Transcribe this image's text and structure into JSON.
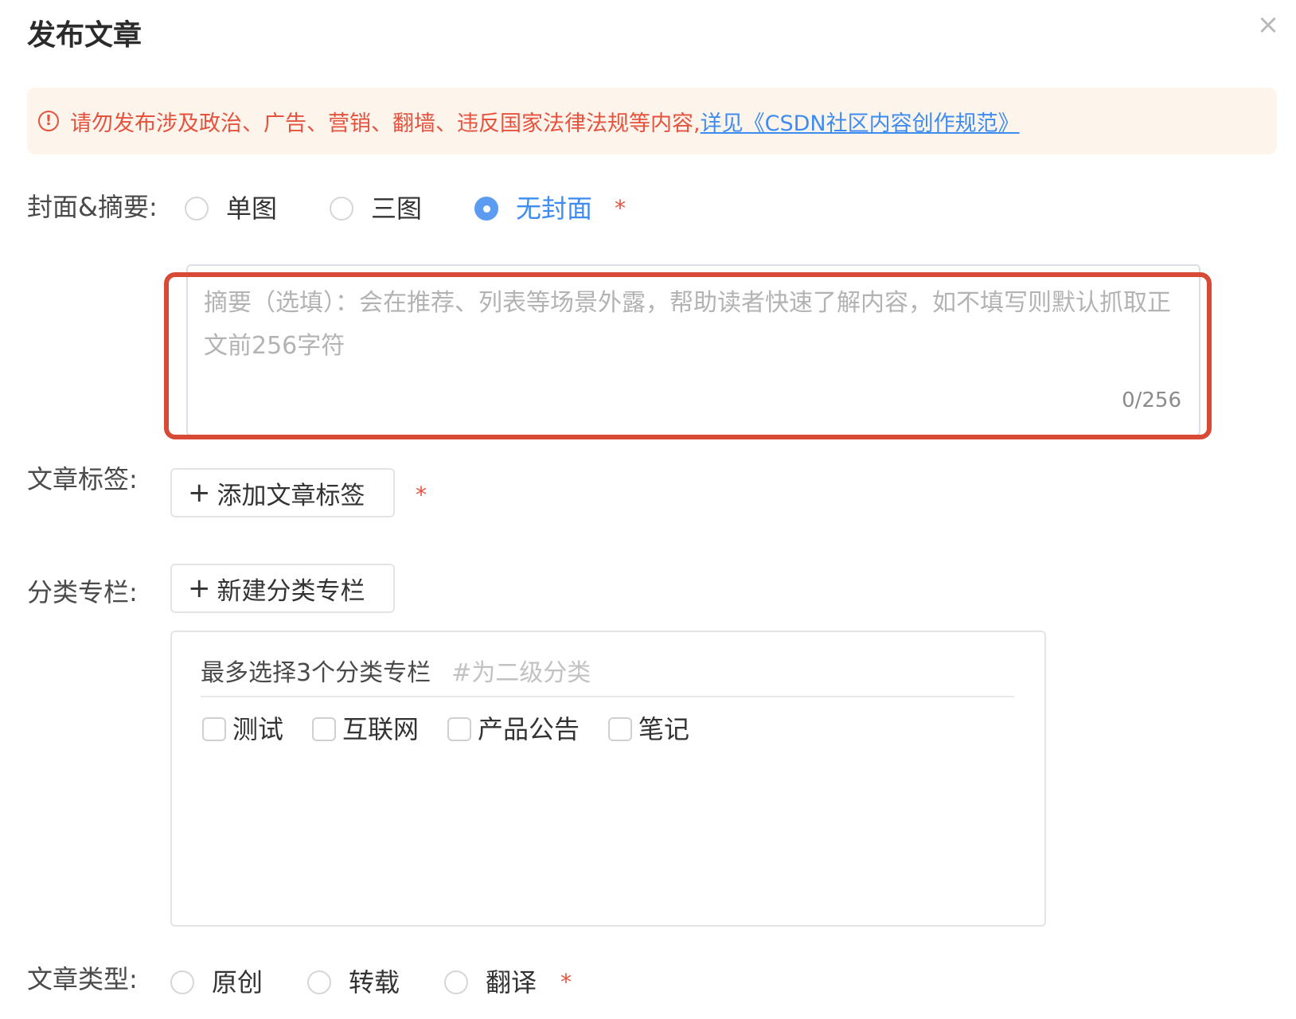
{
  "dialog": {
    "title": "发布文章",
    "close_icon": "close-icon"
  },
  "alert": {
    "icon": "exclamation-circle-icon",
    "text": "请勿发布涉及政治、广告、营销、翻墙、违反国家法律法规等内容,",
    "link_text": "详见《CSDN社区内容创作规范》"
  },
  "cover": {
    "label": "封面&摘要:",
    "options": [
      "单图",
      "三图",
      "无封面"
    ],
    "selected": "无封面",
    "required_mark": "*"
  },
  "summary": {
    "placeholder": "摘要（选填）：会在推荐、列表等场景外露，帮助读者快速了解内容，如不填写则默认抓取正文前256字符",
    "count": "0/256"
  },
  "tags": {
    "label": "文章标签:",
    "add_button": "添加文章标签",
    "required_mark": "*"
  },
  "category": {
    "label": "分类专栏:",
    "new_button": "新建分类专栏",
    "hint_main": "最多选择3个分类专栏",
    "hint_sub": "#为二级分类",
    "options": [
      "测试",
      "互联网",
      "产品公告",
      "笔记"
    ]
  },
  "article_type": {
    "label": "文章类型:",
    "options": [
      "原创",
      "转载",
      "翻译"
    ],
    "required_mark": "*"
  },
  "colors": {
    "accent": "#3f8cf0",
    "danger": "#e5533f",
    "highlight": "#d84a36",
    "alert_bg": "#fdf5eb"
  }
}
